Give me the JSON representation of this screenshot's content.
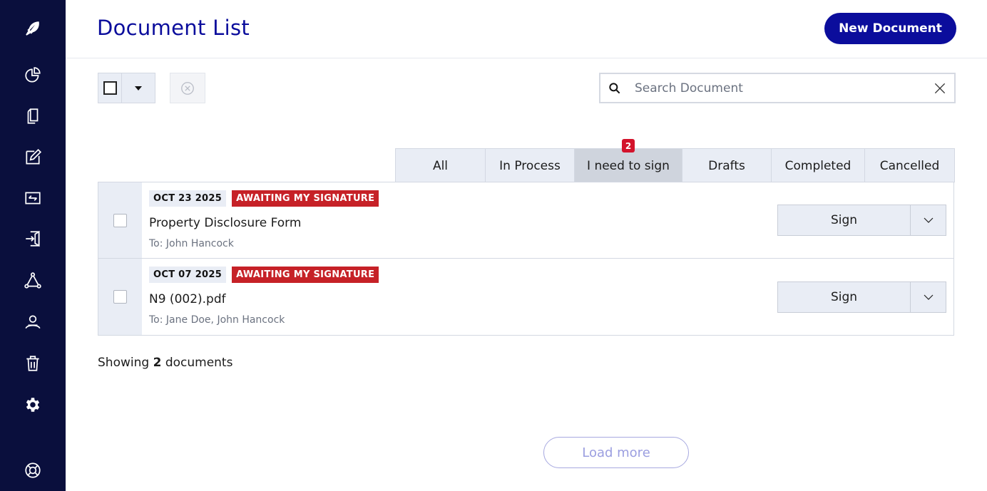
{
  "header": {
    "title": "Document List",
    "new_document_label": "New Document"
  },
  "sidebar": {
    "items": [
      {
        "icon": "feather-logo-icon"
      },
      {
        "icon": "pie-chart-icon"
      },
      {
        "icon": "documents-icon"
      },
      {
        "icon": "edit-icon"
      },
      {
        "icon": "transfer-icon"
      },
      {
        "icon": "sign-in-icon"
      },
      {
        "icon": "workflow-icon"
      },
      {
        "icon": "contacts-icon"
      },
      {
        "icon": "trash-icon"
      },
      {
        "icon": "gear-icon"
      },
      {
        "icon": "help-lifebuoy-icon"
      }
    ]
  },
  "search": {
    "placeholder": "Search Document",
    "value": ""
  },
  "tabs": [
    {
      "label": "All"
    },
    {
      "label": "In Process"
    },
    {
      "label": "I need to sign",
      "badge": "2",
      "active": true
    },
    {
      "label": "Drafts"
    },
    {
      "label": "Completed"
    },
    {
      "label": "Cancelled"
    }
  ],
  "documents": [
    {
      "date": "OCT 23 2025",
      "status": "AWAITING MY SIGNATURE",
      "name": "Property Disclosure Form",
      "to_prefix": "To:",
      "recipients": [
        "John Hancock"
      ],
      "action": "Sign"
    },
    {
      "date": "OCT 07 2025",
      "status": "AWAITING MY SIGNATURE",
      "name": "N9 (002).pdf",
      "to_prefix": "To:",
      "recipients": [
        "Jane Doe",
        "John Hancock"
      ],
      "action": "Sign"
    }
  ],
  "footer": {
    "showing_prefix": "Showing",
    "count": "2",
    "showing_suffix": "documents",
    "load_more_label": "Load more"
  },
  "colors": {
    "sidebar": "#0a0f3d",
    "brand": "#0b0d9c",
    "status_red": "#c62127",
    "badge_red": "#d3132b"
  }
}
